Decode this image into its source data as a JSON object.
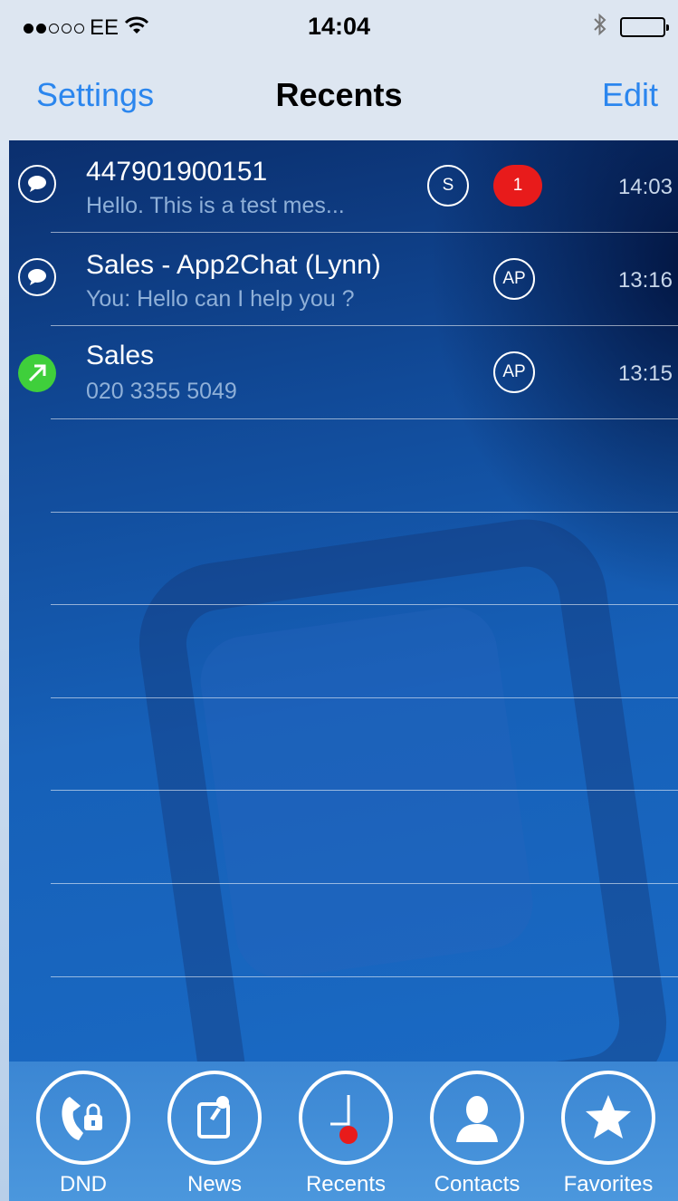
{
  "status_bar": {
    "carrier": "EE",
    "time": "14:04"
  },
  "nav": {
    "left_label": "Settings",
    "title": "Recents",
    "right_label": "Edit"
  },
  "recents": [
    {
      "type": "chat",
      "title": "447901900151",
      "subtitle": "Hello.  This is a test mes...",
      "tag": "S",
      "unread": "1",
      "time": "14:03"
    },
    {
      "type": "chat",
      "title": "Sales - App2Chat (Lynn)",
      "subtitle": "You: Hello can I help you ?",
      "tag": "AP",
      "time": "13:16"
    },
    {
      "type": "outgoing-call",
      "title": "Sales",
      "subtitle": "020 3355 5049",
      "tag": "AP",
      "time": "13:15"
    }
  ],
  "tabs": [
    {
      "label": "DND",
      "icon": "dnd-phone-lock-icon"
    },
    {
      "label": "News",
      "icon": "news-pin-icon"
    },
    {
      "label": "Recents",
      "icon": "clock-icon"
    },
    {
      "label": "Contacts",
      "icon": "person-icon"
    },
    {
      "label": "Favorites",
      "icon": "star-icon"
    }
  ],
  "colors": {
    "accent": "#2b86ee",
    "badge_red": "#e81b1b",
    "call_green": "#3fcf3b",
    "tab_bar": "#3b86d3"
  }
}
